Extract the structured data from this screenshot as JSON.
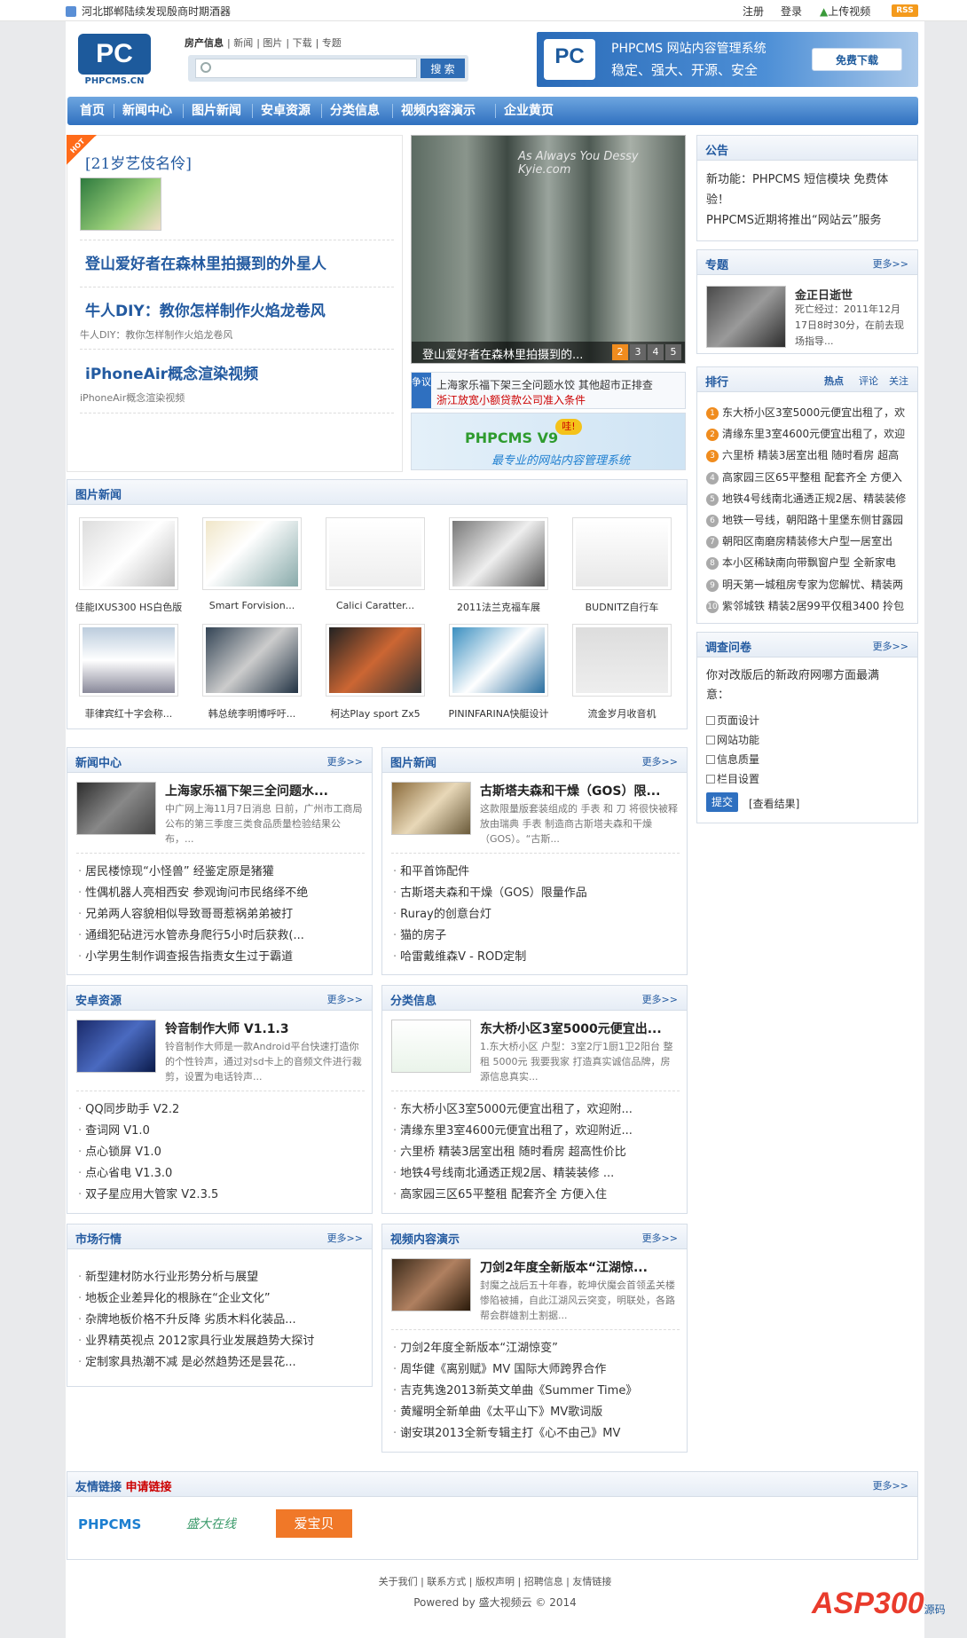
{
  "topbar": {
    "ticker": "河北邯郸陆续发现殷商时期酒器",
    "register": "注册",
    "login": "登录",
    "upload": "上传视频",
    "rss": "RSS"
  },
  "search": {
    "tabs": [
      "房产信息",
      "新闻",
      "图片",
      "下载",
      "专题"
    ],
    "placeholder": "",
    "button": "搜 索"
  },
  "logo": {
    "text": "PC",
    "caption": "PHPCMS.CN"
  },
  "banner": {
    "title": "PHPCMS 网站内容管理系统",
    "slogan": "稳定、强大、开源、安全",
    "download": "免费下载",
    "logo": "PC"
  },
  "nav": [
    "首页",
    "新闻中心",
    "图片新闻",
    "安卓资源",
    "分类信息",
    "视频内容演示",
    "企业黄页"
  ],
  "hot": {
    "badge": "HOT",
    "title": "[21岁艺伎名伶]",
    "items": [
      {
        "title": "登山爱好者在森林里拍摄到的外星人",
        "desc": ""
      },
      {
        "title": "牛人DIY：教你怎样制作火焰龙卷风",
        "desc": "牛人DIY：教你怎样制作火焰龙卷风"
      },
      {
        "title": "iPhoneAir概念渲染视频",
        "desc": "iPhoneAir概念渲染视频"
      }
    ]
  },
  "slider": {
    "caption": "登山爱好者在森林里拍摄到的...",
    "pages": [
      "1",
      "2",
      "3",
      "4",
      "5"
    ],
    "watermark": "As Always You Dessy  Kyie.com"
  },
  "dispute": {
    "tag": "争议",
    "lines": [
      "上海家乐福下架三全问题水饺 其他超市正排查",
      "浙江放宽小额贷款公司准入条件"
    ]
  },
  "v9": {
    "title": "PHPCMS V9",
    "badge": "哇!",
    "slogan": "最专业的网站内容管理系统"
  },
  "notice": {
    "title": "公告",
    "lines": [
      "新功能：PHPCMS 短信模块 免费体验！",
      "PHPCMS近期将推出“网站云”服务"
    ]
  },
  "topic": {
    "title": "专题",
    "more": "更多>>",
    "name": "金正日逝世",
    "desc": "死亡经过：2011年12月17日8时30分，在前去现场指导..."
  },
  "ranking": {
    "title": "排行",
    "tabs": [
      "热点",
      "评论",
      "关注"
    ],
    "items": [
      "东大桥小区3室5000元便宜出租了，欢",
      "清缘东里3室4600元便宜出租了，欢迎",
      "六里桥 精装3居室出租 随时看房 超高",
      "高家园三区65平整租 配套齐全 方便入",
      "地铁4号线南北通透正规2居、精装装修",
      "地铁一号线，朝阳路十里堡东侧甘露园",
      "朝阳区南磨房精装修大户型一居室出",
      "本小区稀缺南向带飘窗户型 全新家电",
      "明天第一城租房专家为您解忧、精装两",
      "紫邻城铁 精装2居99平仅租3400 拎包"
    ]
  },
  "survey": {
    "title": "调查问卷",
    "more": "更多>>",
    "question": "你对改版后的新政府网哪方面最满意：",
    "options": [
      "页面设计",
      "网站功能",
      "信息质量",
      "栏目设置"
    ],
    "submit": "提交",
    "results": "[查看结果]"
  },
  "picnews": {
    "title": "图片新闻",
    "items": [
      "佳能IXUS300 HS白色版",
      "Smart Forvision...",
      "Calici Caratter...",
      "2011法兰克福车展",
      "BUDNITZ自行车",
      "菲律宾红十字会称...",
      "韩总统李明博呼吁...",
      "柯达Play sport Zx5",
      "PININFARINA快艇设计",
      "流金岁月收音机"
    ]
  },
  "sections": [
    {
      "title": "新闻中心",
      "more": "更多>>",
      "ftitle": "上海家乐福下架三全问题水...",
      "fdesc": "中广网上海11月7日消息 日前，广州市工商局公布的第三季度三类食品质量检验结果公布，...",
      "list": [
        "居民楼惊现“小怪兽” 经鉴定原是猪獾",
        "性偶机器人亮相西安 参观询问市民络绎不绝",
        "兄弟两人容貌相似导致哥哥惹祸弟弟被打",
        "通缉犯砧进污水管赤身爬行5小时后获救(...",
        "小学男生制作调查报告指责女生过于霸道"
      ]
    },
    {
      "title": "图片新闻",
      "more": "更多>>",
      "ftitle": "古斯塔夫森和干燥（GOS）限...",
      "fdesc": "这款限量版套装组成的 手表 和 刀 将很快被释放由瑞典 手表 制造商古斯塔夫森和干燥（GOS）。“古斯...",
      "list": [
        "和平首饰配件",
        "古斯塔夫森和干燥（GOS）限量作品",
        "Ruray的创意台灯",
        "猫的房子",
        "哈雷戴维森V - ROD定制"
      ]
    },
    {
      "title": "安卓资源",
      "more": "更多>>",
      "ftitle": "铃音制作大师 V1.1.3",
      "fdesc": "铃音制作大师是一款Android平台快速打造你的个性铃声，通过对sd卡上的音频文件进行裁剪，设置为电话铃声...",
      "list": [
        "QQ同步助手 V2.2",
        "查词网 V1.0",
        "点心锁屏 V1.0",
        "点心省电 V1.3.0",
        "双子星应用大管家 V2.3.5"
      ]
    },
    {
      "title": "分类信息",
      "more": "更多>>",
      "ftitle": "东大桥小区3室5000元便宜出...",
      "fdesc": "1.东大桥小区 户型：3室2厅1厨1卫2阳台 整租 5000元 我要我家 打造真实诚信品牌，房源信息真实...",
      "list": [
        "东大桥小区3室5000元便宜出租了，欢迎附...",
        "清缘东里3室4600元便宜出租了，欢迎附近...",
        "六里桥 精装3居室出租 随时看房 超高性价比",
        "地铁4号线南北通透正规2居、精装装修 ...",
        "高家园三区65平整租 配套齐全 方便入住"
      ]
    },
    {
      "title": "市场行情",
      "more": "更多>>",
      "list": [
        "新型建材防水行业形势分析与展望",
        "地板企业差异化的根脉在“企业文化”",
        "杂牌地板价格不升反降 劣质木料化装品...",
        "业界精英视点 2012家具行业发展趋势大探讨",
        "定制家具热潮不减 是必然趋势还是昙花..."
      ]
    },
    {
      "title": "视频内容演示",
      "more": "更多>>",
      "ftitle": "刀剑2年度全新版本“江湖惊...",
      "fdesc": "封魔之战后五十年春，乾坤伏魔会首领孟关楼惨陷被捕，自此江湖风云突变，明联处，各路帮会群雄割土割据...",
      "list": [
        "刀剑2年度全新版本“江湖惊变”",
        "周华健《离别赋》MV 国际大师跨界合作",
        "吉克隽逸2013新英文单曲《Summer Time》",
        "黄耀明全新单曲《太平山下》MV歌词版",
        "谢安琪2013全新专辑主打《心不由己》MV"
      ]
    }
  ],
  "links": {
    "title": "友情链接",
    "apply": "申请链接",
    "more": "更多>>",
    "logos": [
      "PHPCMS",
      "盛大在线",
      "爱宝贝"
    ]
  },
  "footer": {
    "links": "关于我们 | 联系方式 | 版权声明 | 招聘信息 | 友情链接",
    "powered": "Powered by 盛大视频云 © 2014"
  },
  "watermark": {
    "text": "ASP300",
    "sub": "源码"
  },
  "colors": {
    "accent": "#235aa0",
    "nav": "#2f70c0",
    "hot": "#ff6b1a"
  }
}
